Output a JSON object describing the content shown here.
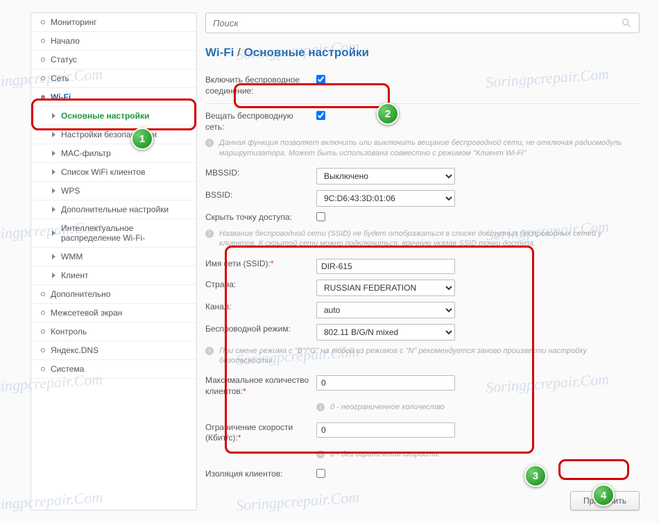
{
  "watermark": "Soringpcrepair.Com",
  "search": {
    "placeholder": "Поиск"
  },
  "breadcrumb": {
    "section": "Wi-Fi",
    "page": "Основные настройки"
  },
  "sidebar": {
    "items": [
      {
        "label": "Мониторинг"
      },
      {
        "label": "Начало"
      },
      {
        "label": "Статус"
      },
      {
        "label": "Сеть"
      },
      {
        "label": "Wi-Fi",
        "expanded": true,
        "active": true,
        "children": [
          {
            "label": "Основные настройки",
            "active": true
          },
          {
            "label": "Настройки безопасности"
          },
          {
            "label": "MAC-фильтр"
          },
          {
            "label": "Список WiFi клиентов"
          },
          {
            "label": "WPS"
          },
          {
            "label": "Дополнительные настройки"
          },
          {
            "label": "Интеллектуальное распределение Wi-Fi-"
          },
          {
            "label": "WMM"
          },
          {
            "label": "Клиент"
          }
        ]
      },
      {
        "label": "Дополнительно"
      },
      {
        "label": "Межсетевой экран"
      },
      {
        "label": "Контроль"
      },
      {
        "label": "Яндекс.DNS"
      },
      {
        "label": "Система"
      }
    ]
  },
  "form": {
    "enable_wireless_label": "Включить беспроводное соединение:",
    "enable_wireless_checked": true,
    "broadcast_label": "Вещать беспроводную сеть:",
    "broadcast_checked": true,
    "broadcast_hint": "Данная функция позволяет включить или выключить вещание беспроводной сети, не отключая радиомодуль маршрутизатора. Может быть использована совместно с режимом \"Клиент Wi-Fi\"",
    "mbssid_label": "MBSSID:",
    "mbssid_value": "Выключено",
    "bssid_label": "BSSID:",
    "bssid_value": "9C:D6:43:3D:01:06",
    "hide_ap_label": "Скрыть точку доступа:",
    "hide_ap_checked": false,
    "hide_ap_hint": "Название беспроводной сети (SSID) не будет отображаться в списке доступных беспроводных сетей у клиентов. К скрытой сети можно подключиться, вручную указав SSID точки доступа.",
    "ssid_label": "Имя сети (SSID):",
    "ssid_value": "DIR-615",
    "country_label": "Страна:",
    "country_value": "RUSSIAN FEDERATION",
    "channel_label": "Канал:",
    "channel_value": "auto",
    "mode_label": "Беспроводной режим:",
    "mode_value": "802.11 B/G/N mixed",
    "mode_hint": "При смене режима с \"B\"/\"G\" на любой из режимов с \"N\" рекомендуется заново произвести настройку безопасности!",
    "max_clients_label": "Максимальное количество клиентов:",
    "max_clients_value": "0",
    "max_clients_hint": "0 - неограниченное количество",
    "speed_limit_label": "Ограничение скорости (Кбит/с):",
    "speed_limit_value": "0",
    "speed_limit_hint": "0 - без ограничения скорости.",
    "isolation_label": "Изоляция клиентов:",
    "isolation_checked": false,
    "apply_label": "Применить"
  },
  "annotations": {
    "badges": [
      "1",
      "2",
      "3",
      "4"
    ]
  }
}
